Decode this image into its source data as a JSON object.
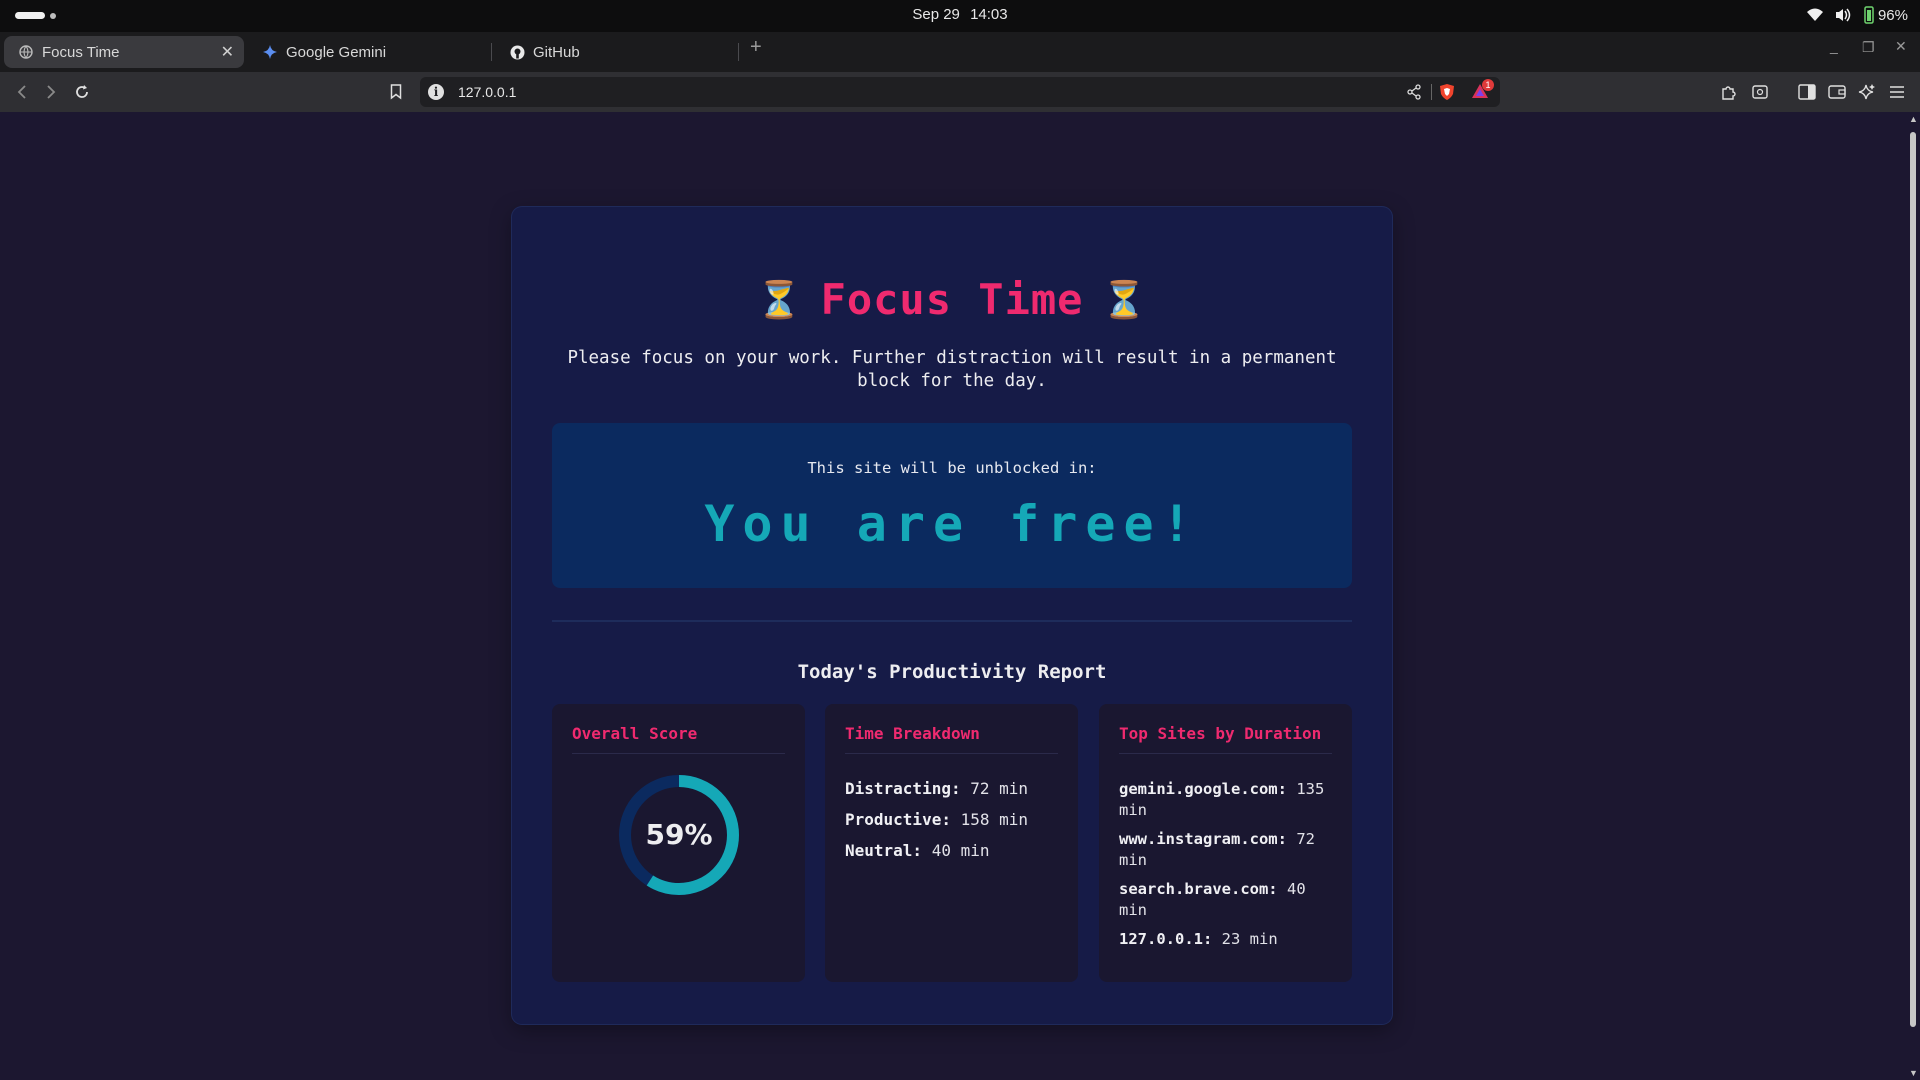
{
  "os": {
    "date": "Sep 29",
    "time": "14:03",
    "battery": "96%"
  },
  "browser": {
    "tabs": [
      {
        "title": "Focus Time",
        "active": true
      },
      {
        "title": "Google Gemini",
        "active": false
      },
      {
        "title": "GitHub",
        "active": false
      }
    ],
    "url": "127.0.0.1",
    "rewards_badge": "1"
  },
  "page": {
    "title": "Focus Time",
    "title_icon": "⏳",
    "subtitle": "Please focus on your work. Further distraction will result in a permanent block for the day.",
    "unblock_label": "This site will be unblocked in:",
    "unblock_status": "You are free!",
    "report_title": "Today's Productivity Report",
    "overall": {
      "heading": "Overall Score",
      "score_label": "59%",
      "score": 0.59
    },
    "breakdown": {
      "heading": "Time Breakdown",
      "rows": [
        {
          "label": "Distracting:",
          "value": "72 min"
        },
        {
          "label": "Productive:",
          "value": "158 min"
        },
        {
          "label": "Neutral:",
          "value": "40 min"
        }
      ]
    },
    "top_sites": {
      "heading": "Top Sites by Duration",
      "rows": [
        {
          "site": "gemini.google.com:",
          "value": "135 min"
        },
        {
          "site": "www.instagram.com:",
          "value": "72 min"
        },
        {
          "site": "search.brave.com:",
          "value": "40 min"
        },
        {
          "site": "127.0.0.1:",
          "value": "23 min"
        }
      ]
    },
    "colors": {
      "accent": "#ef2a6f",
      "teal": "#15a8b7",
      "background": "#1c1730",
      "card": "#161b47"
    }
  }
}
